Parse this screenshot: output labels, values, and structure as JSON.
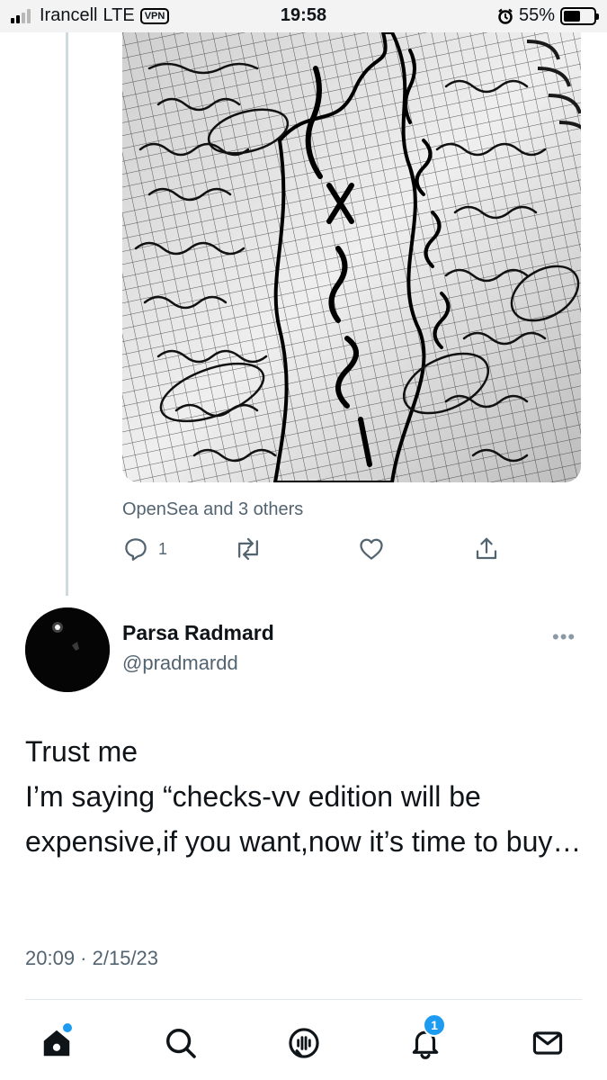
{
  "status_bar": {
    "carrier": "Irancell",
    "network": "LTE",
    "vpn": "VPN",
    "time": "19:58",
    "battery_percent": "55%",
    "battery_level": 0.55,
    "icons": [
      "signal-icon",
      "alarm-icon",
      "battery-icon"
    ]
  },
  "previous_tweet": {
    "image_icon": "notebook-photo",
    "attribution": "OpenSea and 3 others",
    "actions": {
      "reply_count": "1",
      "icons": [
        "reply-icon",
        "retweet-icon",
        "like-icon",
        "share-icon"
      ]
    }
  },
  "tweet": {
    "display_name": "Parsa Radmard",
    "handle": "@pradmardd",
    "more_label": "•••",
    "text": "Trust me\nI’m saying “checks-vv edition will be expensive,if you want,now it’s time to buy…",
    "timestamp": "20:09 · 2/15/23"
  },
  "tab_bar": {
    "items": [
      "home-icon",
      "search-icon",
      "spaces-icon",
      "notifications-icon",
      "messages-icon"
    ],
    "notifications_badge": "1",
    "accent_color": "#1d9bf0"
  }
}
